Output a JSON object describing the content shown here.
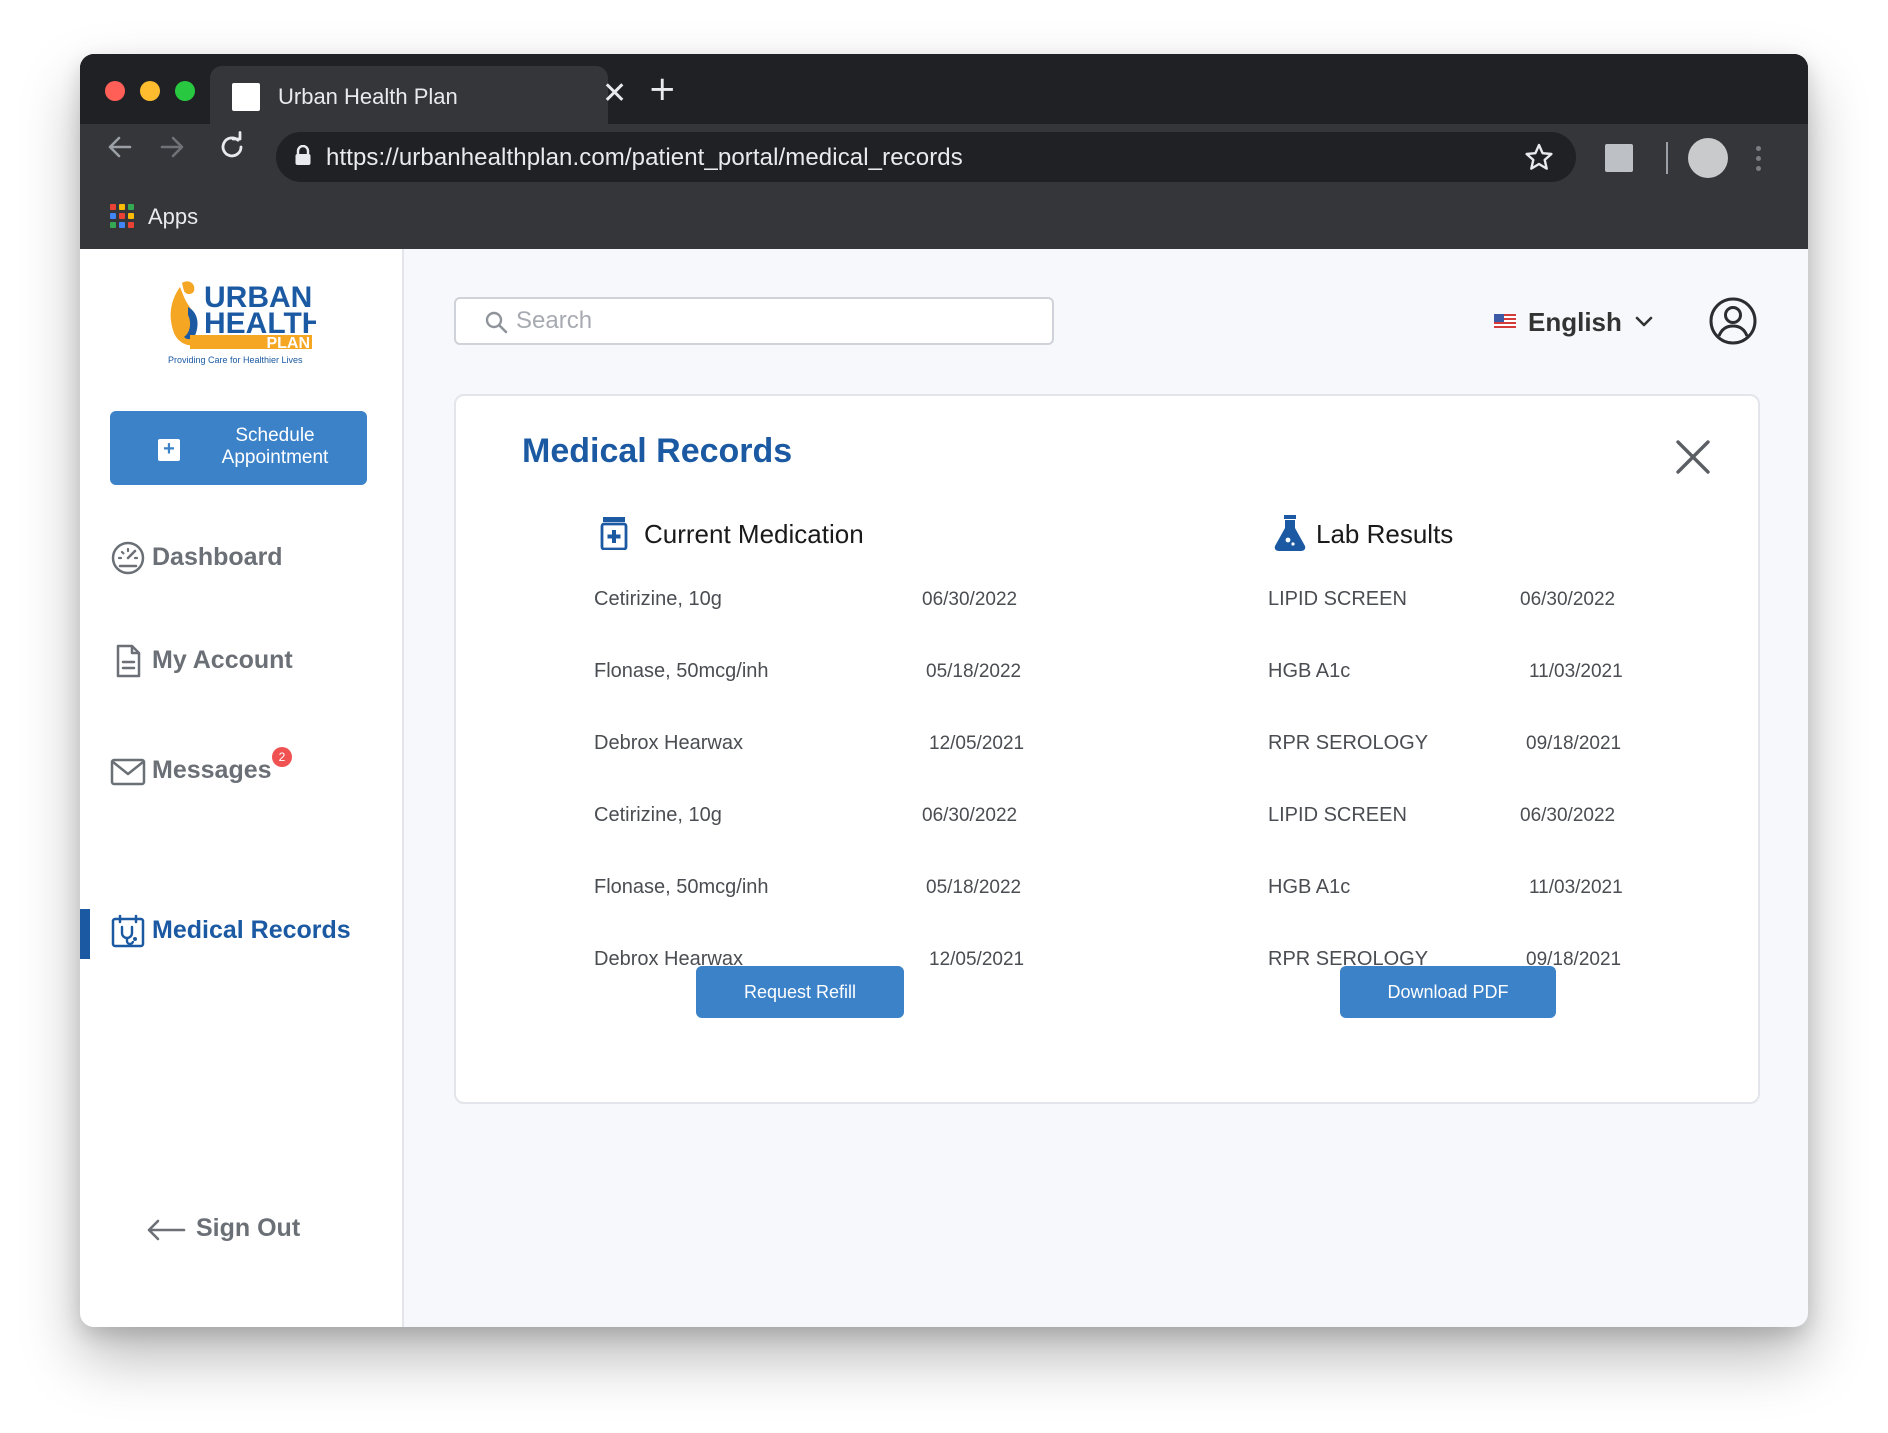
{
  "browser": {
    "tab_title": "Urban Health Plan",
    "url": "https://urbanhealthplan.com/patient_portal/medical_records",
    "bookmark_apps": "Apps"
  },
  "logo": {
    "line1": "URBAN",
    "line2": "HEALTH",
    "line3": "PLAN",
    "tagline": "Providing Care for Healthier Lives"
  },
  "sidebar": {
    "schedule_line1": "Schedule",
    "schedule_line2": "Appointment",
    "items": [
      {
        "label": "Dashboard",
        "icon": "dashboard-gauge-icon"
      },
      {
        "label": "My Account",
        "icon": "document-icon"
      },
      {
        "label": "Messages",
        "icon": "envelope-icon",
        "badge": "2"
      },
      {
        "label": "Medical Records",
        "icon": "medical-records-icon",
        "active": true
      }
    ],
    "signout": "Sign Out"
  },
  "header": {
    "search_placeholder": "Search",
    "language": "English"
  },
  "records": {
    "title": "Medical Records",
    "medication": {
      "heading": "Current Medication",
      "rows": [
        {
          "name": "Cetirizine, 10g",
          "date": "06/30/2022"
        },
        {
          "name": "Flonase, 50mcg/inh",
          "date": "05/18/2022"
        },
        {
          "name": "Debrox Hearwax",
          "date": "12/05/2021"
        },
        {
          "name": "Cetirizine, 10g",
          "date": "06/30/2022"
        },
        {
          "name": "Flonase, 50mcg/inh",
          "date": "05/18/2022"
        },
        {
          "name": "Debrox Hearwax",
          "date": "12/05/2021"
        }
      ],
      "button": "Request Refill"
    },
    "labs": {
      "heading": "Lab Results",
      "rows": [
        {
          "name": "LIPID SCREEN",
          "date": "06/30/2022"
        },
        {
          "name": "HGB A1c",
          "date": "11/03/2021"
        },
        {
          "name": "RPR SEROLOGY",
          "date": "09/18/2021"
        },
        {
          "name": "LIPID SCREEN",
          "date": "06/30/2022"
        },
        {
          "name": "HGB A1c",
          "date": "11/03/2021"
        },
        {
          "name": "RPR SEROLOGY",
          "date": "09/18/2021"
        }
      ],
      "button": "Download PDF"
    }
  },
  "colors": {
    "brand_blue": "#1b5aa3",
    "button_blue": "#3b82c9",
    "badge_red": "#f05252"
  }
}
